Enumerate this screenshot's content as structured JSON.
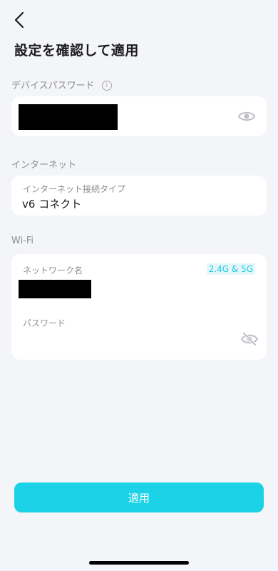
{
  "header": {
    "title": "設定を確認して適用",
    "back_icon": "chevron-left-icon"
  },
  "device_password": {
    "section_label": "デバイスパスワード",
    "info_icon": "i",
    "value": "[redacted]",
    "visibility_icon": "eye-icon"
  },
  "internet": {
    "section_label": "インターネット",
    "field_label": "インターネット接続タイプ",
    "field_value": "v6 コネクト"
  },
  "wifi": {
    "section_label": "Wi-Fi",
    "network_name_label": "ネットワーク名",
    "band_badge": "2.4G & 5G",
    "network_name_value": "[redacted]",
    "password_label": "パスワード",
    "password_visibility_icon": "eye-off-icon"
  },
  "footer": {
    "apply_label": "適用"
  },
  "colors": {
    "accent": "#1cd2e6",
    "background": "#f4f5f9",
    "card": "#ffffff",
    "label": "#8e8e93",
    "badge_text": "#1fc8de",
    "badge_bg": "#e3f7fb"
  }
}
